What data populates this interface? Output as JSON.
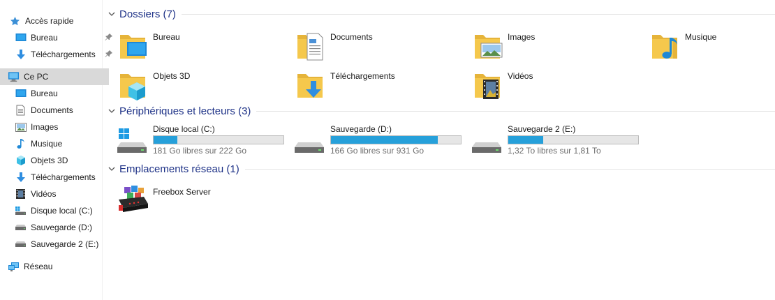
{
  "sidebar": {
    "quick_access": "Accès rapide",
    "qa_items": [
      "Bureau",
      "Téléchargements"
    ],
    "this_pc": "Ce PC",
    "pc_items": [
      "Bureau",
      "Documents",
      "Images",
      "Musique",
      "Objets 3D",
      "Téléchargements",
      "Vidéos",
      "Disque local (C:)",
      "Sauvegarde (D:)",
      "Sauvegarde 2 (E:)"
    ],
    "network": "Réseau"
  },
  "groups": {
    "folders": "Dossiers (7)",
    "devices": "Périphériques et lecteurs (3)",
    "network": "Emplacements réseau (1)"
  },
  "folders": [
    {
      "label": "Bureau",
      "icon": "desktop-folder-icon"
    },
    {
      "label": "Documents",
      "icon": "documents-folder-icon"
    },
    {
      "label": "Images",
      "icon": "pictures-folder-icon"
    },
    {
      "label": "Musique",
      "icon": "music-folder-icon"
    },
    {
      "label": "Objets 3D",
      "icon": "3d-objects-folder-icon"
    },
    {
      "label": "Téléchargements",
      "icon": "downloads-folder-icon"
    },
    {
      "label": "Vidéos",
      "icon": "videos-folder-icon"
    }
  ],
  "drives": [
    {
      "name": "Disque local (C:)",
      "free": "181 Go libres sur 222 Go",
      "used_fraction": 0.185
    },
    {
      "name": "Sauvegarde (D:)",
      "free": "166 Go libres sur 931 Go",
      "used_fraction": 0.822
    },
    {
      "name": "Sauvegarde 2 (E:)",
      "free": "1,32 To libres sur 1,81 To",
      "used_fraction": 0.271
    }
  ],
  "network_locations": [
    {
      "label": "Freebox Server",
      "icon": "freebox-server-icon"
    }
  ],
  "colors": {
    "accent": "#26a0da",
    "header_text": "#1e3287",
    "selection": "#d9d9d9",
    "folder": "#f5c84c"
  }
}
